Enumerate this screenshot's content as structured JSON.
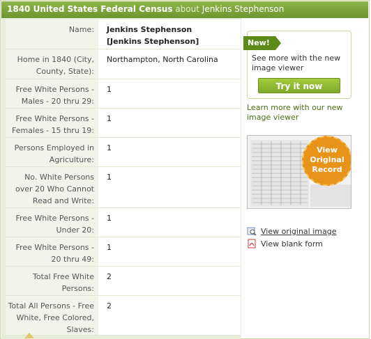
{
  "header": {
    "title": "1840 United States Federal Census",
    "about": "about",
    "person": "Jenkins Stephenson"
  },
  "record": {
    "name_label": "Name:",
    "name_value": "Jenkins Stephenson",
    "name_alt": "[Jenkins Stephenson]",
    "rows": [
      {
        "label": "Home in 1840 (City, County, State):",
        "value": "Northampton, North Carolina"
      },
      {
        "label": "Free White Persons - Males - 20 thru 29:",
        "value": "1"
      },
      {
        "label": "Free White Persons - Females - 15 thru 19:",
        "value": "1"
      },
      {
        "label": "Persons Employed in Agriculture:",
        "value": "1"
      },
      {
        "label": "No. White Persons over 20 Who Cannot Read and Write:",
        "value": "1"
      },
      {
        "label": "Free White Persons - Under 20:",
        "value": "1"
      },
      {
        "label": "Free White Persons - 20 thru 49:",
        "value": "1"
      },
      {
        "label": "Total Free White Persons:",
        "value": "2"
      },
      {
        "label": "Total All Persons - Free White, Free Colored, Slaves:",
        "value": "2"
      }
    ]
  },
  "sidebar": {
    "new_tag": "New!",
    "new_text": "See more with the new image viewer",
    "try_button": "Try it now",
    "learn_more": "Learn more with our new image viewer",
    "badge_text": "View Original Record",
    "link_view_original": "View original image",
    "link_view_blank": "View blank form"
  },
  "colors": {
    "header_green": "#7ba23a",
    "accent_orange": "#e8941a",
    "button_green": "#8fbb33"
  }
}
